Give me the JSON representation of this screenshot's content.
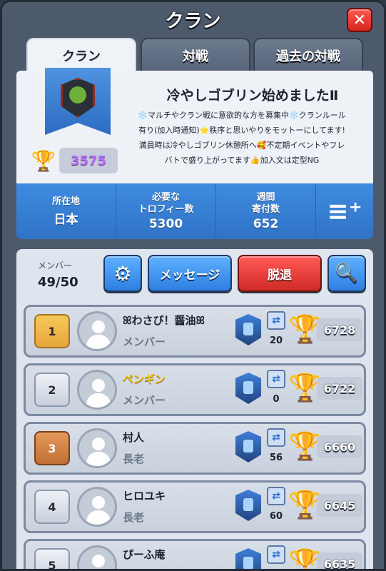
{
  "header": {
    "title": "クラン",
    "close_icon": "close-icon"
  },
  "tabs": [
    {
      "label": "クラン",
      "active": true
    },
    {
      "label": "対戦",
      "active": false
    },
    {
      "label": "過去の対戦",
      "active": false
    }
  ],
  "clan": {
    "name": "冷やしゴブリン始めましたⅡ",
    "description": "❄️マルチやクラン戦に意欲的な方を募集中❄️クランルール有り(加入時通知)⭐秩序と思いやりをモットーにしてます!満員時は冷やしゴブリン休憩所へ🥰不定期イベントやフレバトで盛り上がってます👍加入文は定型NG",
    "trophies": "3575"
  },
  "stats": [
    {
      "label": "所在地",
      "value": "日本"
    },
    {
      "label": "必要な\nトロフィー数",
      "value": "5300"
    },
    {
      "label": "週間\n寄付数",
      "value": "652"
    }
  ],
  "members_header": {
    "label": "メンバー",
    "count": "49/50",
    "message_button": "メッセージ",
    "leave_button": "脱退"
  },
  "members": [
    {
      "rank": "1",
      "name": "ꕤわさび！醤油ꕤ",
      "role": "メンバー",
      "donations": "20",
      "trophies": "6728"
    },
    {
      "rank": "2",
      "name": "ペンギン",
      "role": "メンバー",
      "donations": "0",
      "trophies": "6722"
    },
    {
      "rank": "3",
      "name": "村人",
      "role": "長老",
      "donations": "56",
      "trophies": "6660"
    },
    {
      "rank": "4",
      "name": "ヒロユキ",
      "role": "長老",
      "donations": "60",
      "trophies": "6645"
    },
    {
      "rank": "5",
      "name": "ぴーふ庵",
      "role": "",
      "donations": "",
      "trophies": "6635"
    }
  ]
}
